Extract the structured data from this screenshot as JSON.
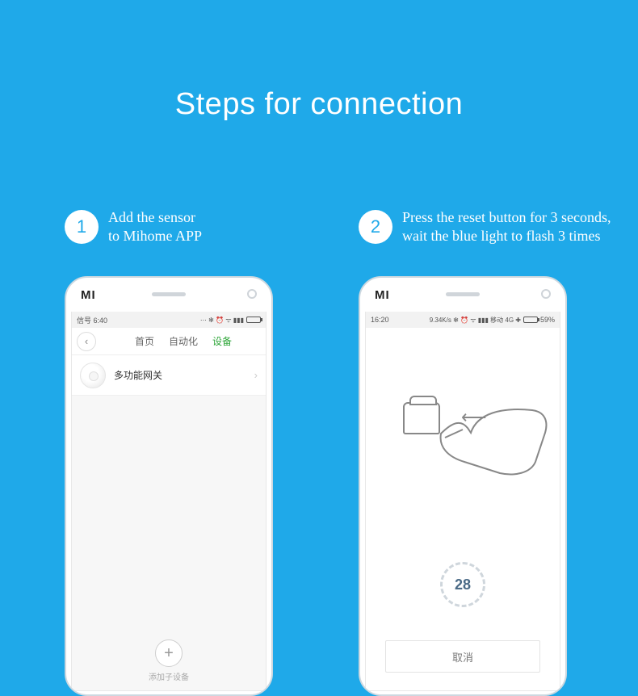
{
  "title": "Steps for connection",
  "steps": [
    {
      "num": "1",
      "text_line1": "Add the sensor",
      "text_line2": "to Mihome APP"
    },
    {
      "num": "2",
      "text_line1": "Press the reset button for 3 seconds,",
      "text_line2": "wait the blue light to flash 3 times"
    }
  ],
  "phone1": {
    "status_time": "信号 6:40",
    "status_icons": "⋯ ✻ ⏰ ᯤ ▮▮▮",
    "tabs": {
      "home": "首页",
      "automation": "自动化",
      "devices": "设备"
    },
    "device_name": "多功能网关",
    "add_label": "添加子设备"
  },
  "phone2": {
    "status_time": "16:20",
    "status_net": "9.34K/s ✻ ⏰ ᯤ ▮▮▮ 移动 4G ✚",
    "status_batt": "59%",
    "countdown": "28",
    "cancel": "取消"
  }
}
